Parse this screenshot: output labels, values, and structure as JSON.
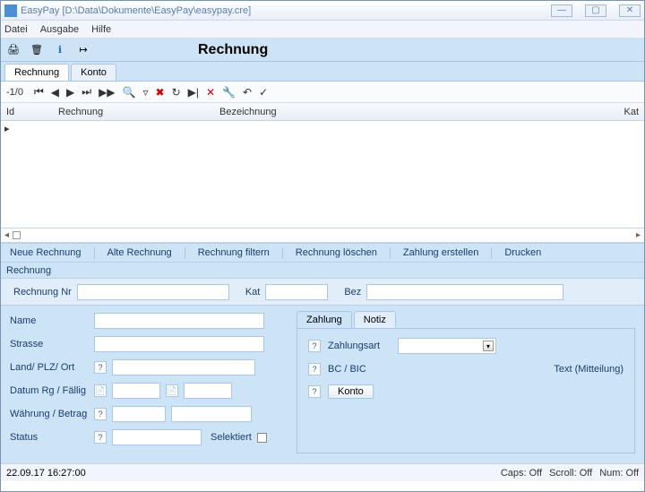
{
  "window": {
    "title": "EasyPay [D:\\Data\\Dokumente\\EasyPay\\easypay.cre]"
  },
  "menu": {
    "file": "Datei",
    "output": "Ausgabe",
    "help": "Hilfe"
  },
  "heading": "Rechnung",
  "maintabs": {
    "rechnung": "Rechnung",
    "konto": "Konto"
  },
  "pager": "-1/0",
  "grid": {
    "id": "Id",
    "rechnung": "Rechnung",
    "bezeichnung": "Bezeichnung",
    "kat": "Kat"
  },
  "actions": {
    "neu": "Neue Rechnung",
    "alte": "Alte Rechnung",
    "filtern": "Rechnung filtern",
    "loeschen": "Rechnung löschen",
    "zahlung": "Zahlung erstellen",
    "drucken": "Drucken"
  },
  "section": "Rechnung",
  "filter": {
    "nr": "Rechnung Nr",
    "kat": "Kat",
    "bez": "Bez"
  },
  "left": {
    "name": "Name",
    "strasse": "Strasse",
    "landplzort": "Land/ PLZ/ Ort",
    "datum": "Datum Rg / Fällig",
    "waehrung": "Währung / Betrag",
    "status": "Status",
    "selektiert": "Selektiert"
  },
  "right": {
    "tabs": {
      "zahlung": "Zahlung",
      "notiz": "Notiz"
    },
    "zahlungsart": "Zahlungsart",
    "bcbic": "BC / BIC",
    "text": "Text (Mitteilung)",
    "konto": "Konto"
  },
  "status": {
    "timestamp": "22.09.17 16:27:00",
    "caps": "Caps: Off",
    "scroll": "Scroll: Off",
    "num": "Num: Off"
  }
}
